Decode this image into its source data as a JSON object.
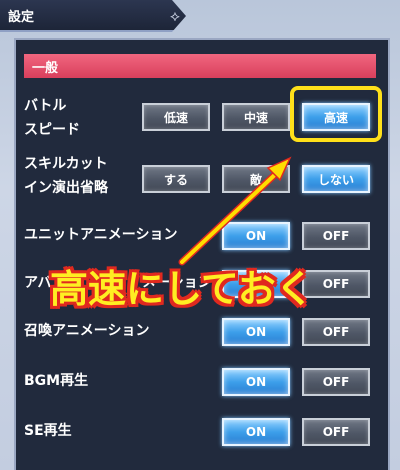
{
  "header": {
    "title": "設定",
    "ornament": "⟡"
  },
  "section": {
    "title": "一般"
  },
  "rows": [
    {
      "label": "バトル\nスピード",
      "options": [
        "低速",
        "中速",
        "高速"
      ],
      "selected": "高速"
    },
    {
      "label": "スキルカット\nイン演出省略",
      "options": [
        "する",
        "敵",
        "しない"
      ],
      "selected": "しない"
    },
    {
      "label": "ユニットアニメーション",
      "options": [
        "ON",
        "OFF"
      ],
      "selected": "ON"
    },
    {
      "label": "アバ",
      "label_tail": "メーション",
      "options": [
        "ON",
        "OFF"
      ],
      "selected": "ON"
    },
    {
      "label": "召喚アニメーション",
      "options": [
        "ON",
        "OFF"
      ],
      "selected": "ON"
    },
    {
      "label": "BGM再生",
      "options": [
        "ON",
        "OFF"
      ],
      "selected": "ON"
    },
    {
      "label": "SE再生",
      "options": [
        "ON",
        "OFF"
      ],
      "selected": "ON"
    }
  ],
  "annotation": {
    "text": "高速にしておく"
  },
  "colors": {
    "accent_pink": "#e8526d",
    "highlight_yellow": "#ffe01a",
    "arrow_yellow": "#ffdd00",
    "annotation_outline": "#e0291f"
  }
}
